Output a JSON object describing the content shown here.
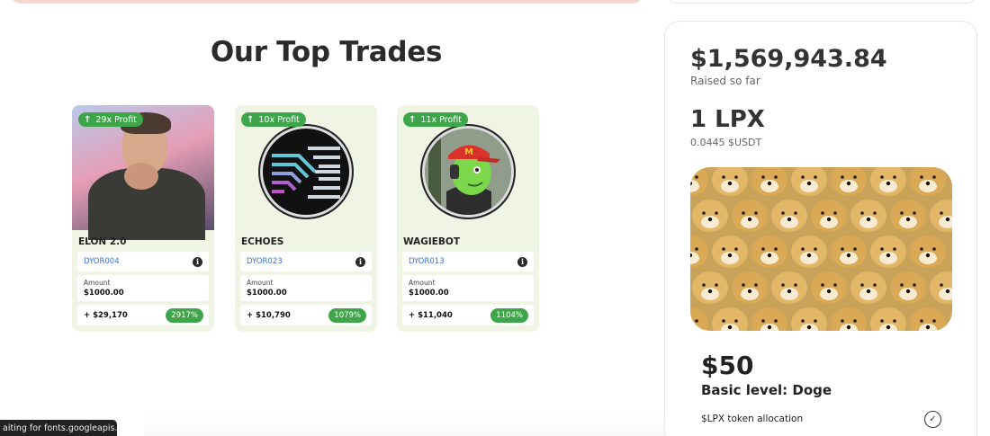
{
  "section_title": "Our Top Trades",
  "cards": [
    {
      "profit_badge": "29x Profit",
      "name": "ELON 2.0",
      "code": "DYOR004",
      "amount_label": "Amount",
      "amount": "$1000.00",
      "gain": "+ $29,170",
      "percent": "2917%"
    },
    {
      "profit_badge": "10x Profit",
      "name": "ECHOES",
      "code": "DYOR023",
      "amount_label": "Amount",
      "amount": "$1000.00",
      "gain": "+ $10,790",
      "percent": "1079%"
    },
    {
      "profit_badge": "11x Profit",
      "name": "WAGIEBOT",
      "code": "DYOR013",
      "amount_label": "Amount",
      "amount": "$1000.00",
      "gain": "+ $11,040",
      "percent": "1104%"
    }
  ],
  "presale": {
    "raised_amount": "$1,569,943.84",
    "raised_label": "Raised so far",
    "token_name": "1 LPX",
    "token_price": "0.0445 $USDT",
    "tier_price": "$50",
    "tier_name": "Basic level: Doge",
    "feature": "$LPX token allocation"
  },
  "bottom_heading": "...",
  "status_text": "aiting for fonts.googleapis....",
  "colors": {
    "accent_green": "#3fa54a",
    "card_bg": "#eff4e4",
    "link_blue": "#3b6fd8"
  }
}
